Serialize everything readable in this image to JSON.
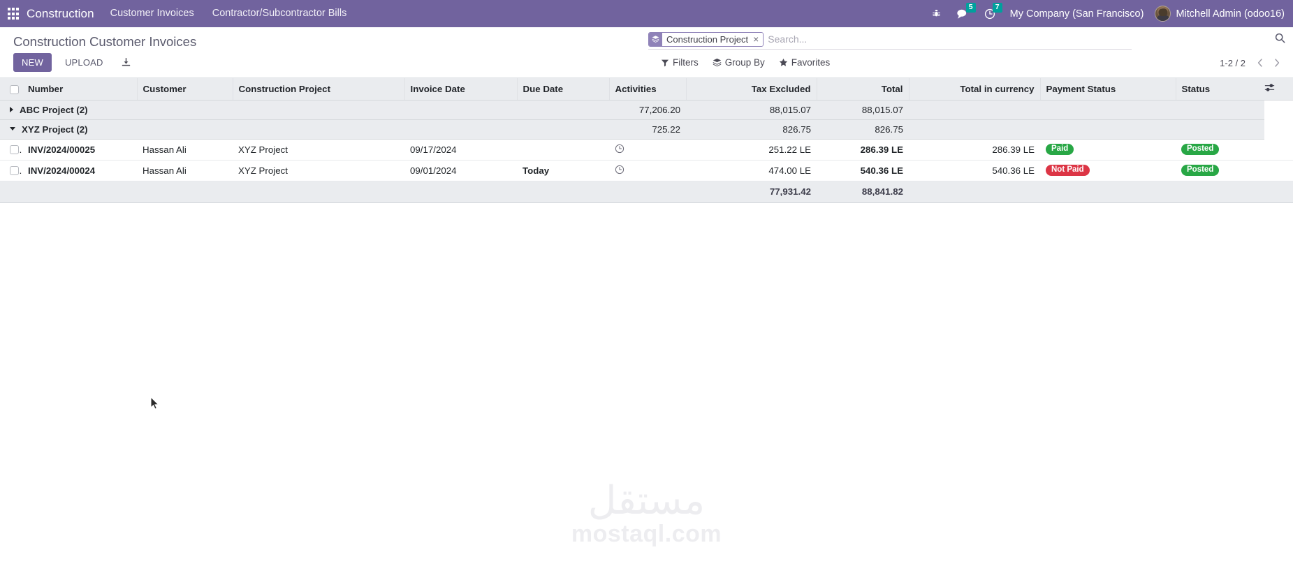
{
  "navbar": {
    "apps_icon": "apps-grid-icon",
    "brand": "Construction",
    "menus": [
      {
        "label": "Customer Invoices"
      },
      {
        "label": "Contractor/Subcontractor Bills"
      }
    ],
    "systray": {
      "bug_icon": "bug-icon",
      "messages_icon": "messages-icon",
      "messages_count": "5",
      "activities_icon": "clock-icon",
      "activities_count": "7"
    },
    "company": "My Company (San Francisco)",
    "user": "Mitchell Admin (odoo16)",
    "background_color": "#71639e",
    "badge_color": "#00a09d"
  },
  "control_panel": {
    "title": "Construction Customer Invoices",
    "buttons": {
      "new_label": "NEW",
      "upload_label": "UPLOAD",
      "import_icon": "import-download-icon"
    },
    "search": {
      "facet_icon": "layers-icon",
      "facet_label": "Construction Project",
      "facet_remove": "×",
      "placeholder": "Search...",
      "value": "",
      "toggle_icon": "search-icon"
    },
    "dropdowns": [
      {
        "icon": "filter-funnel-icon",
        "label": "Filters"
      },
      {
        "icon": "layers-icon",
        "label": "Group By"
      },
      {
        "icon": "star-icon",
        "label": "Favorites"
      }
    ],
    "pager": {
      "value": "1-2 / 2",
      "prev_icon": "chevron-left-icon",
      "next_icon": "chevron-right-icon"
    }
  },
  "list": {
    "columns": [
      {
        "label": "Number",
        "align": "left"
      },
      {
        "label": "Customer",
        "align": "left"
      },
      {
        "label": "Construction Project",
        "align": "left"
      },
      {
        "label": "Invoice Date",
        "align": "left"
      },
      {
        "label": "Due Date",
        "align": "left"
      },
      {
        "label": "Activities",
        "align": "left"
      },
      {
        "label": "Tax Excluded",
        "align": "right"
      },
      {
        "label": "Total",
        "align": "right"
      },
      {
        "label": "Total in currency",
        "align": "right"
      },
      {
        "label": "Payment Status",
        "align": "left"
      },
      {
        "label": "Status",
        "align": "left"
      }
    ],
    "optional_columns_icon": "sliders-icon",
    "groups": [
      {
        "label": "ABC Project (2)",
        "expanded": false,
        "tax_excluded": "77,206.20",
        "total": "88,015.07",
        "total_in_currency": "88,015.07",
        "rows": []
      },
      {
        "label": "XYZ Project (2)",
        "expanded": true,
        "tax_excluded": "725.22",
        "total": "826.75",
        "total_in_currency": "826.75",
        "rows": [
          {
            "number": "INV/2024/00025",
            "customer": "Hassan Ali",
            "project": "XYZ Project",
            "invoice_date": "09/17/2024",
            "due_date": "",
            "due_today": false,
            "activity_icon": "clock-icon",
            "tax_excluded": "251.22 LE",
            "total": "286.39 LE",
            "total_in_currency": "286.39 LE",
            "payment_status": "Paid",
            "payment_status_color": "#28a745",
            "status": "Posted",
            "status_color": "#28a745"
          },
          {
            "number": "INV/2024/00024",
            "customer": "Hassan Ali",
            "project": "XYZ Project",
            "invoice_date": "09/01/2024",
            "due_date": "Today",
            "due_today": true,
            "activity_icon": "clock-icon",
            "tax_excluded": "474.00 LE",
            "total": "540.36 LE",
            "total_in_currency": "540.36 LE",
            "payment_status": "Not Paid",
            "payment_status_color": "#dc3545",
            "status": "Posted",
            "status_color": "#28a745"
          }
        ]
      }
    ],
    "footer": {
      "tax_excluded": "77,931.42",
      "total": "88,841.82",
      "total_in_currency": ""
    }
  },
  "watermark": {
    "arabic": "مستقل",
    "latin": "mostaql.com"
  }
}
